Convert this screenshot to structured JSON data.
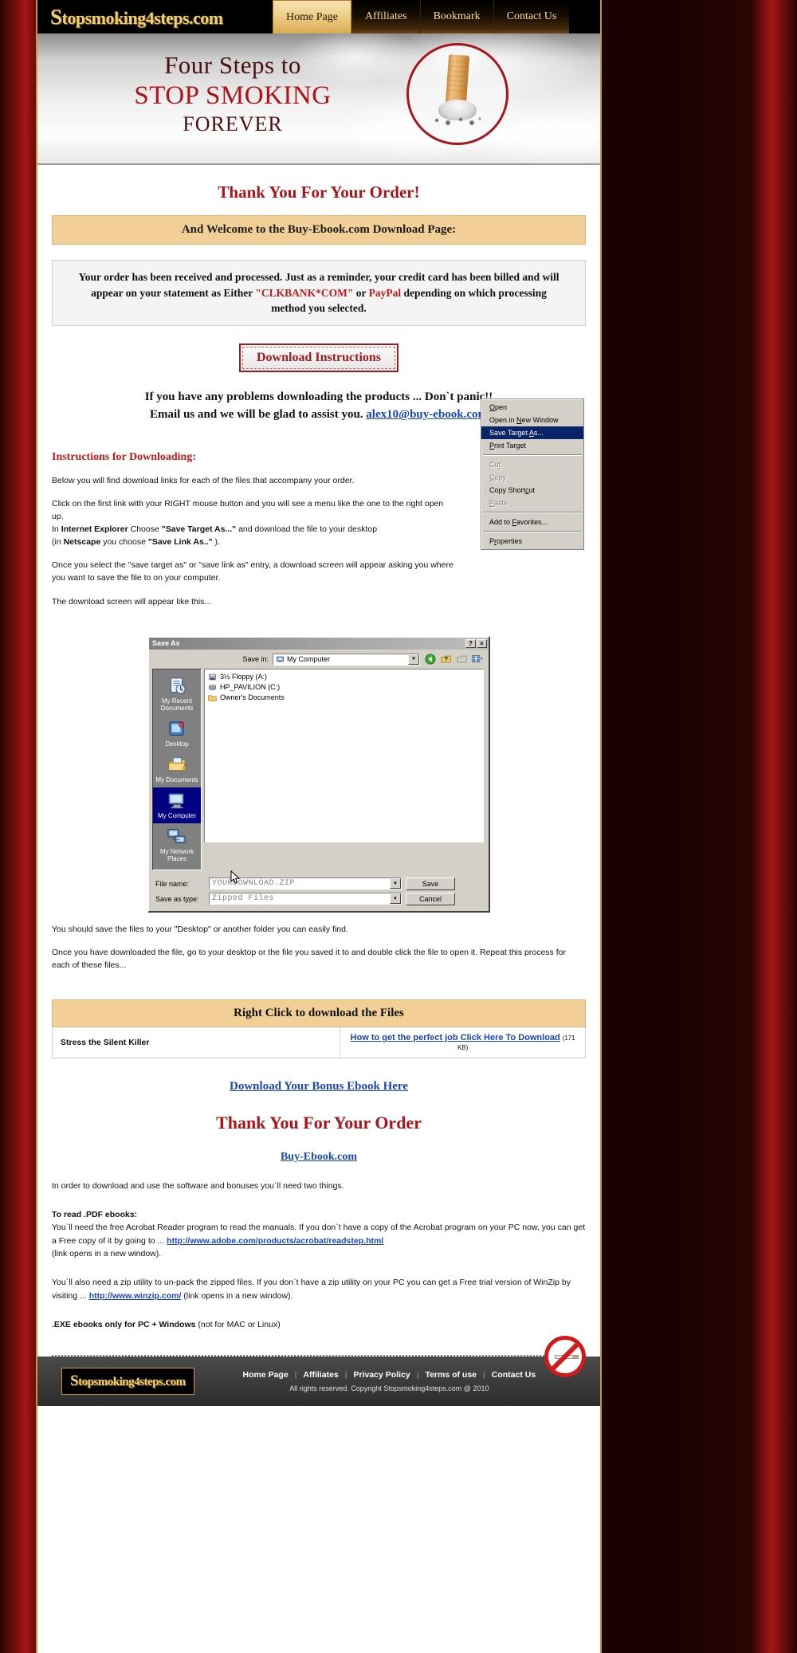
{
  "site": {
    "logo_first": "S",
    "logo_rest": "topsmoking4steps.com"
  },
  "nav": {
    "items": [
      {
        "label": "Home Page",
        "active": true
      },
      {
        "label": "Affiliates",
        "active": false
      },
      {
        "label": "Bookmark",
        "active": false
      },
      {
        "label": "Contact Us",
        "active": false
      }
    ]
  },
  "hero": {
    "line1": "Four Steps to",
    "line2": "STOP SMOKING",
    "line3": "FOREVER"
  },
  "main": {
    "thank_you": "Thank You For Your Order!",
    "welcome_bar": "And Welcome to the Buy-Ebook.com Download Page:",
    "order_notice_1": "Your order has been received and processed. Just as a reminder, your credit card has been billed and will appear on your statement as Either ",
    "order_notice_hl1": "\"CLKBANK*COM\"",
    "order_notice_2": " or ",
    "order_notice_hl2": "PayPal",
    "order_notice_3": " depending on which processing method you selected.",
    "download_instructions_button": "Download Instructions",
    "panic_line1": "If you have any problems downloading the products ... Don`t panic!!",
    "panic_line2": "Email us and we will be glad to assist you. ",
    "panic_email": "alex10@buy-ebook.com ",
    "instructions_title": "Instructions for Downloading:",
    "p1": "Below you will find download links for each of the files that accompany your order.",
    "p2a": "Click on the first link with your RIGHT mouse button and you will see a menu like the one to the right open up.",
    "p2b_pre": "In ",
    "p2b_ie": "Internet Explorer",
    "p2b_mid": " Choose ",
    "p2b_sta": "\"Save Target As...\"",
    "p2b_post": " and download the file to your desktop",
    "p2c_pre": "(in ",
    "p2c_ns": "Netscape",
    "p2c_mid": " you choose ",
    "p2c_sla": "\"Save Link As..\"",
    "p2c_post": " ).",
    "p3": "Once you select the \"save target as\" or \"save link as\" entry, a download screen will appear asking you where you want to save the file to on your computer.",
    "p4": "The download screen will appear like this...",
    "p5": "You should save the files to your \"Desktop\" or another folder you can easily find.",
    "p6": "Once you have downloaded the file, go to your desktop or the file you saved it to and double click the file to open it. Repeat this process for each of these files..."
  },
  "context_menu": {
    "items": [
      {
        "label": "Open",
        "accel": "O",
        "state": "normal"
      },
      {
        "label": "Open in New Window",
        "accel": "N",
        "state": "normal"
      },
      {
        "label": "Save Target As...",
        "accel": "A",
        "state": "selected"
      },
      {
        "label": "Print Target",
        "accel": "P",
        "state": "normal"
      },
      {
        "sep": true
      },
      {
        "label": "Cut",
        "accel": "t",
        "state": "disabled"
      },
      {
        "label": "Copy",
        "accel": "C",
        "state": "disabled"
      },
      {
        "label": "Copy Shortcut",
        "accel": "c",
        "state": "normal"
      },
      {
        "label": "Paste",
        "accel": "P",
        "state": "disabled"
      },
      {
        "sep": true
      },
      {
        "label": "Add to Favorites...",
        "accel": "F",
        "state": "normal"
      },
      {
        "sep": true
      },
      {
        "label": "Properties",
        "accel": "r",
        "state": "normal"
      }
    ]
  },
  "save_dialog": {
    "title": "Save As",
    "help_button": "?",
    "close_button": "×",
    "save_in_label": "Save in:",
    "save_in_value": "My Computer",
    "places": [
      {
        "label": "My Recent Documents",
        "icon": "recent-documents-icon",
        "selected": false
      },
      {
        "label": "Desktop",
        "icon": "desktop-icon",
        "selected": false
      },
      {
        "label": "My Documents",
        "icon": "my-documents-icon",
        "selected": false
      },
      {
        "label": "My Computer",
        "icon": "my-computer-icon",
        "selected": true
      },
      {
        "label": "My Network Places",
        "icon": "network-places-icon",
        "selected": false
      }
    ],
    "files": [
      {
        "label": "3½ Floppy (A:)",
        "icon": "floppy-drive-icon"
      },
      {
        "label": "HP_PAVILION (C:)",
        "icon": "hard-drive-icon"
      },
      {
        "label": "Owner's Documents",
        "icon": "folder-icon"
      }
    ],
    "file_name_label": "File name:",
    "file_name_value": "YOURDOWNLOAD.ZIP",
    "save_as_type_label": "Save as type:",
    "save_as_type_value": "Zipped Files",
    "save_button": "Save",
    "cancel_button": "Cancel"
  },
  "download_table": {
    "header": "Right Click to download the Files",
    "rows": [
      {
        "name": "Stress the Silent Killer",
        "link": "How to get the perfect job Click Here To Download",
        "size": "(171 KB)"
      }
    ]
  },
  "bonus": {
    "link": "Download Your Bonus Ebook Here",
    "thank_you": "Thank You For Your Order",
    "site_link": "Buy-Ebook.com "
  },
  "lower": {
    "intro": "In order to download and use the software and bonuses you`ll need two things.",
    "pdf_title": "To read .PDF ebooks:",
    "pdf_text_1": "You`ll need the free Acrobat Reader program to read the manuals. If you don`t have a copy of the Acrobat program on your PC now, you can get a Free copy of it by going to ... ",
    "pdf_link": "http://www.adobe.com/products/acrobat/readstep.html ",
    "pdf_text_2": "(link opens in a new window).",
    "zip_text_1": "You`ll also need a zip utility to un-pack the zipped files. If you don`t have a zip utility on your PC you can get a Free trial version of WinZip by visiting ... ",
    "zip_link": "http://www.winzip.com/",
    "zip_text_2": " (link opens in a new window).",
    "exe_bold": ".EXE ebooks only for PC + Windows ",
    "exe_rest": "(not for MAC or Linux)"
  },
  "footer": {
    "nav": [
      "Home Page",
      "Affiliates",
      "Privacy Policy",
      "Terms of use",
      "Contact Us"
    ],
    "copyright": "All rights reserved. Copyright Stopsmoking4steps.com @ 2010"
  },
  "colors": {
    "brand_gold": "#f0cf6e",
    "accent_red": "#ab1418",
    "tan_bar": "#f2cf96",
    "link_blue": "#1a44bb"
  }
}
